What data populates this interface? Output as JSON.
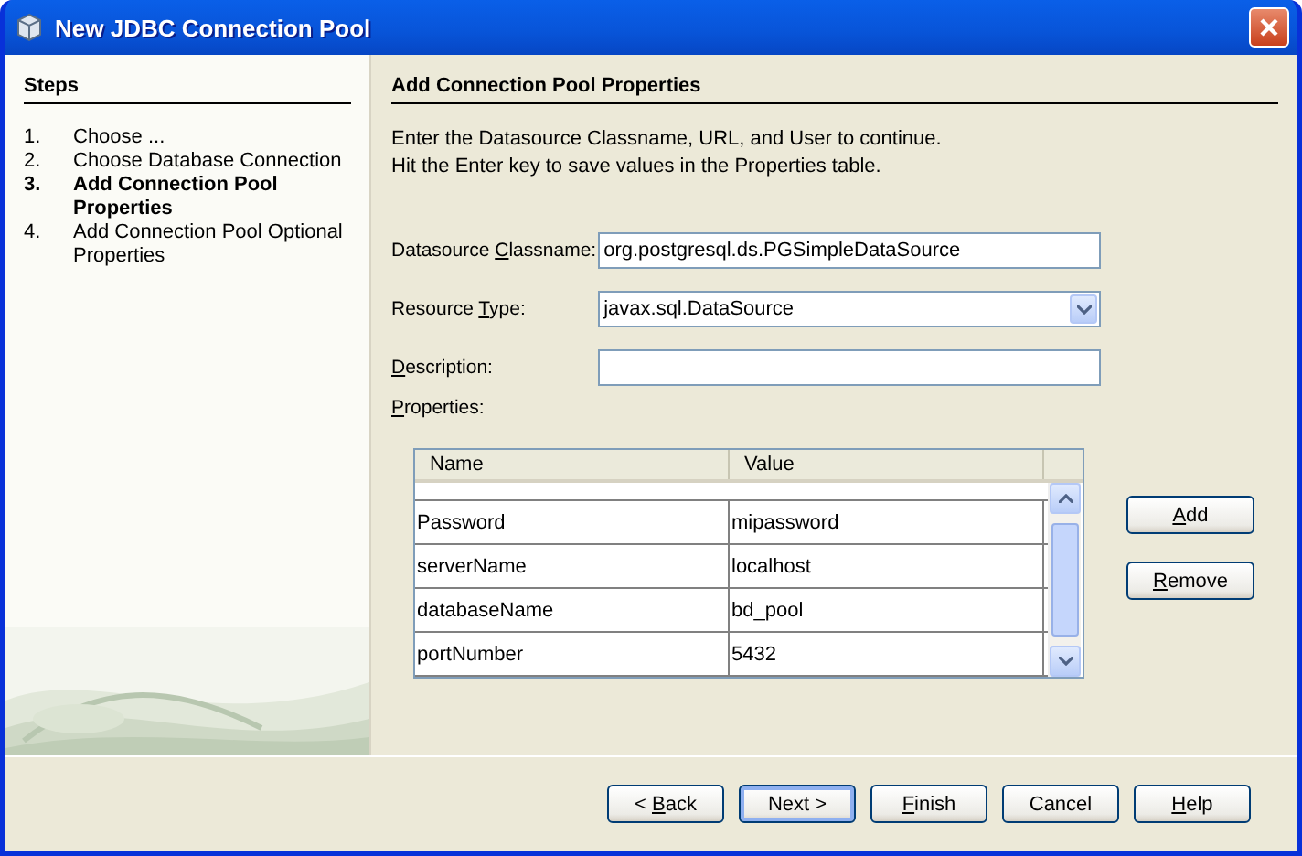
{
  "window": {
    "title": "New JDBC Connection Pool"
  },
  "steps": {
    "title": "Steps",
    "items": [
      {
        "number": "1.",
        "label": "Choose ...",
        "selected": false
      },
      {
        "number": "2.",
        "label": "Choose Database Connection",
        "selected": false
      },
      {
        "number": "3.",
        "label": "Add Connection Pool Properties",
        "selected": true
      },
      {
        "number": "4.",
        "label": "Add Connection Pool Optional Properties",
        "selected": false
      }
    ]
  },
  "panel": {
    "title": "Add Connection Pool Properties",
    "instructions": [
      "Enter the Datasource Classname, URL, and User to continue.",
      "Hit the Enter key to save values in the Properties table."
    ]
  },
  "fields": [
    {
      "kind": "text",
      "label": {
        "before": "Datasource ",
        "key": "C",
        "after": "lassname:"
      },
      "value": "org.postgresql.ds.PGSimpleDataSource"
    },
    {
      "kind": "dropdown",
      "label": {
        "before": "Resource ",
        "key": "T",
        "after": "ype:"
      },
      "value": "javax.sql.DataSource"
    },
    {
      "kind": "text",
      "label": {
        "key": "D",
        "after": "escription:"
      }
    }
  ],
  "properties": {
    "label": {
      "key": "P",
      "after": "roperties:"
    },
    "columns": [
      "Name",
      "Value"
    ],
    "rows": [
      {
        "name": "Password",
        "value": "mipassword"
      },
      {
        "name": "serverName",
        "value": "localhost"
      },
      {
        "name": "databaseName",
        "value": "bd_pool"
      },
      {
        "name": "portNumber",
        "value": "5432"
      }
    ],
    "buttons": [
      {
        "label": {
          "key": "A",
          "after": "dd"
        }
      },
      {
        "label": {
          "key": "R",
          "after": "emove"
        }
      }
    ]
  },
  "buttons": [
    {
      "label": {
        "before": "< ",
        "key": "B",
        "after": "ack"
      },
      "default": false
    },
    {
      "label": {
        "before": "Next >"
      },
      "default": true
    },
    {
      "label": {
        "key": "F",
        "after": "inish"
      },
      "default": false
    },
    {
      "label": {
        "before": "Cancel"
      },
      "default": false
    },
    {
      "label": {
        "key": "H",
        "after": "elp"
      },
      "default": false
    }
  ]
}
